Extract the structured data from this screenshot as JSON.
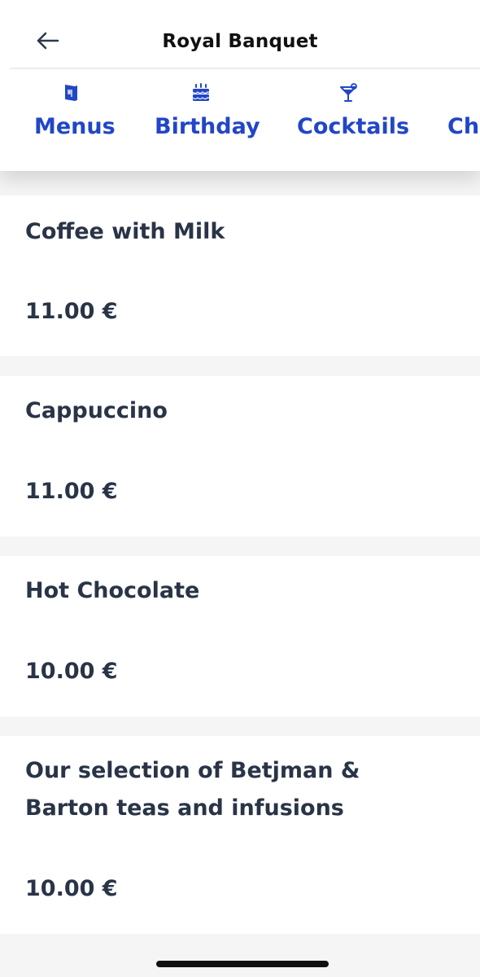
{
  "header": {
    "title": "Royal Banquet",
    "back_icon": "arrow-left-icon"
  },
  "tabs": [
    {
      "label": "Menus",
      "icon": "menu-book-icon"
    },
    {
      "label": "Birthday",
      "icon": "birthday-cake-icon"
    },
    {
      "label": "Cocktails",
      "icon": "cocktail-glass-icon"
    },
    {
      "label": "Cha",
      "icon": "tab-icon"
    }
  ],
  "items": [
    {
      "name": "Coffee with Milk",
      "price": "11.00 €"
    },
    {
      "name": "Cappuccino",
      "price": "11.00 €"
    },
    {
      "name": "Hot Chocolate",
      "price": "10.00 €"
    },
    {
      "name": "Our selection of Betjman & Barton teas and infusions",
      "price": "10.00 €"
    }
  ],
  "colors": {
    "accent": "#2146c7",
    "text": "#293447",
    "background": "#f5f5f5",
    "card": "#ffffff"
  }
}
